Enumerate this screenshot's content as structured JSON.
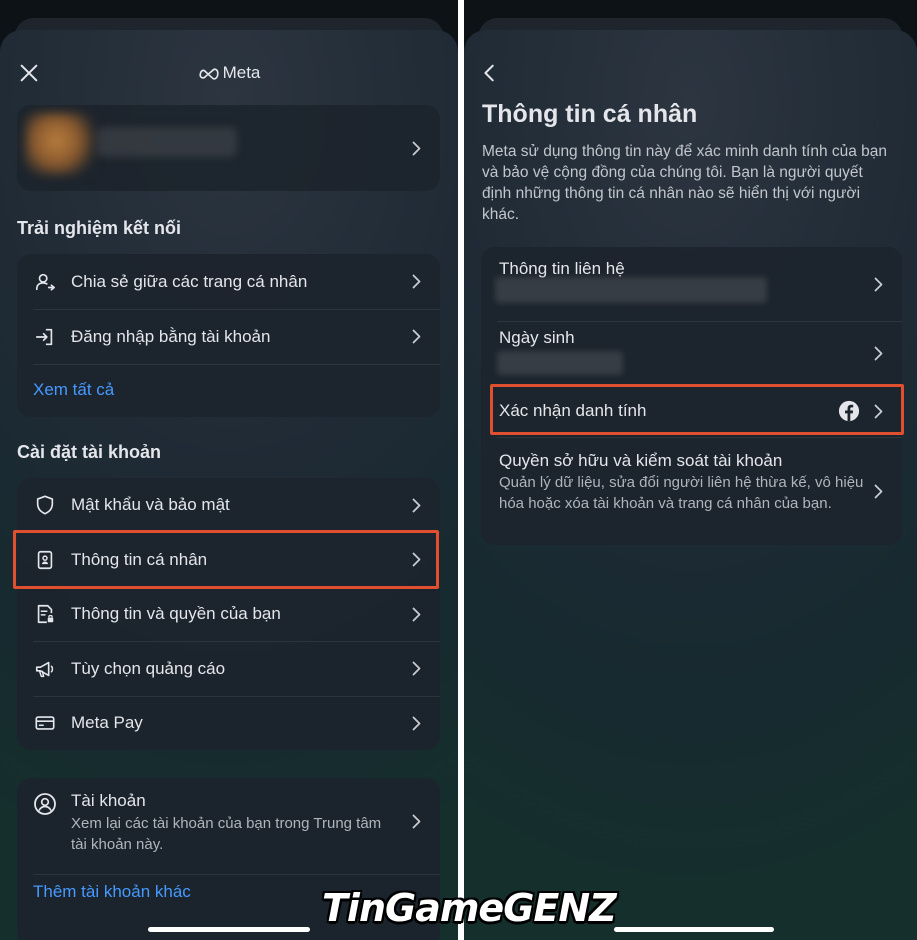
{
  "left": {
    "header": {
      "brand": "Meta"
    },
    "profile_card": {
      "name": ""
    },
    "connected_section": {
      "title": "Trải nghiệm kết nối",
      "items": [
        {
          "label": "Chia sẻ giữa các trang cá nhân",
          "icon": "profile-share-icon"
        },
        {
          "label": "Đăng nhập bằng tài khoản",
          "icon": "login-icon"
        }
      ],
      "see_all": "Xem tất cả"
    },
    "account_settings": {
      "title": "Cài đặt tài khoản",
      "items": [
        {
          "label": "Mật khẩu và bảo mật",
          "icon": "shield-icon"
        },
        {
          "label": "Thông tin cá nhân",
          "icon": "id-card-icon",
          "highlighted": true
        },
        {
          "label": "Thông tin và quyền của bạn",
          "icon": "document-lock-icon"
        },
        {
          "label": "Tùy chọn quảng cáo",
          "icon": "megaphone-icon"
        },
        {
          "label": "Meta Pay",
          "icon": "credit-card-icon"
        }
      ]
    },
    "accounts_card": {
      "title": "Tài khoản",
      "description": "Xem lại các tài khoản của bạn trong Trung tâm tài khoản này.",
      "add_link": "Thêm tài khoản khác",
      "icon": "user-circle-icon"
    }
  },
  "right": {
    "title": "Thông tin cá nhân",
    "description": "Meta sử dụng thông tin này để xác minh danh tính của bạn và bảo vệ cộng đồng của chúng tôi. Bạn là người quyết định những thông tin cá nhân nào sẽ hiển thị với người khác.",
    "items": [
      {
        "title": "Thông tin liên hệ",
        "value": ""
      },
      {
        "title": "Ngày sinh",
        "value": ""
      },
      {
        "title": "Xác nhận danh tính",
        "icon": "facebook-icon",
        "highlighted": true
      },
      {
        "title": "Quyền sở hữu và kiểm soát tài khoản",
        "subtitle": "Quản lý dữ liệu, sửa đổi người liên hệ thừa kế, vô hiệu hóa hoặc xóa tài khoản và trang cá nhân của bạn."
      }
    ]
  },
  "watermark": "TinGameGENZ",
  "colors": {
    "accent_link": "#4599ff",
    "highlight": "#e0502e",
    "card": "#1c242c"
  }
}
